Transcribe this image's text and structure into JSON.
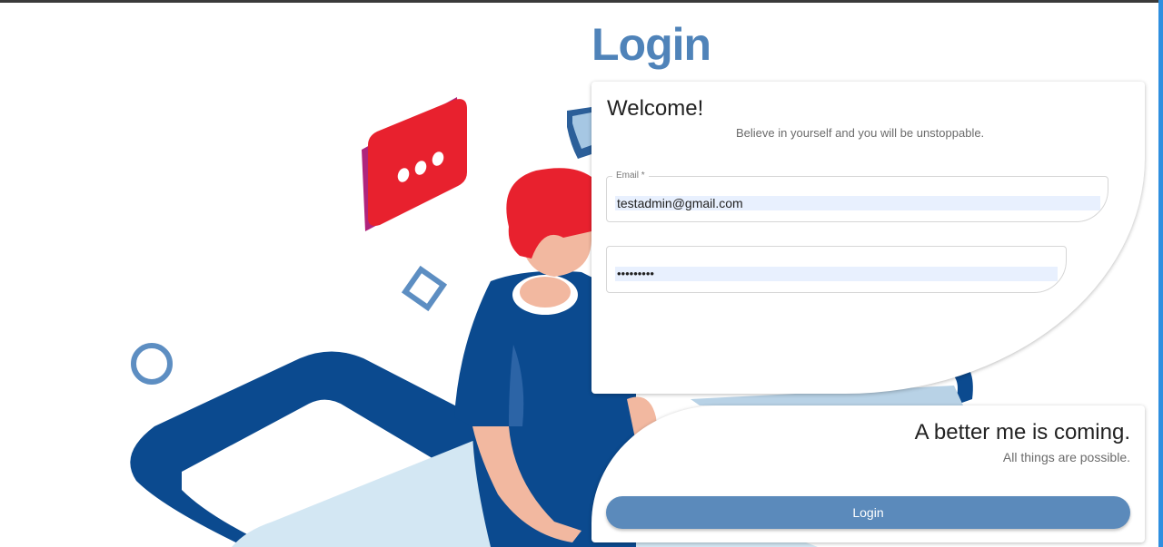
{
  "page": {
    "title": "Login"
  },
  "login_card": {
    "heading": "Welcome!",
    "motto": "Believe in yourself and you will be unstoppable.",
    "email": {
      "label": "Email *",
      "value": "testadmin@gmail.com"
    },
    "password": {
      "value": "•••••••••"
    }
  },
  "footer_card": {
    "tagline": "A better me is coming.",
    "subtagline": "All things are possible.",
    "login_button_label": "Login"
  },
  "colors": {
    "accent": "#4f83b9",
    "button": "#5b8abb",
    "autofill": "#e8f0fe",
    "illustration_blue": "#0b4a8f",
    "illustration_red": "#e8212e"
  }
}
